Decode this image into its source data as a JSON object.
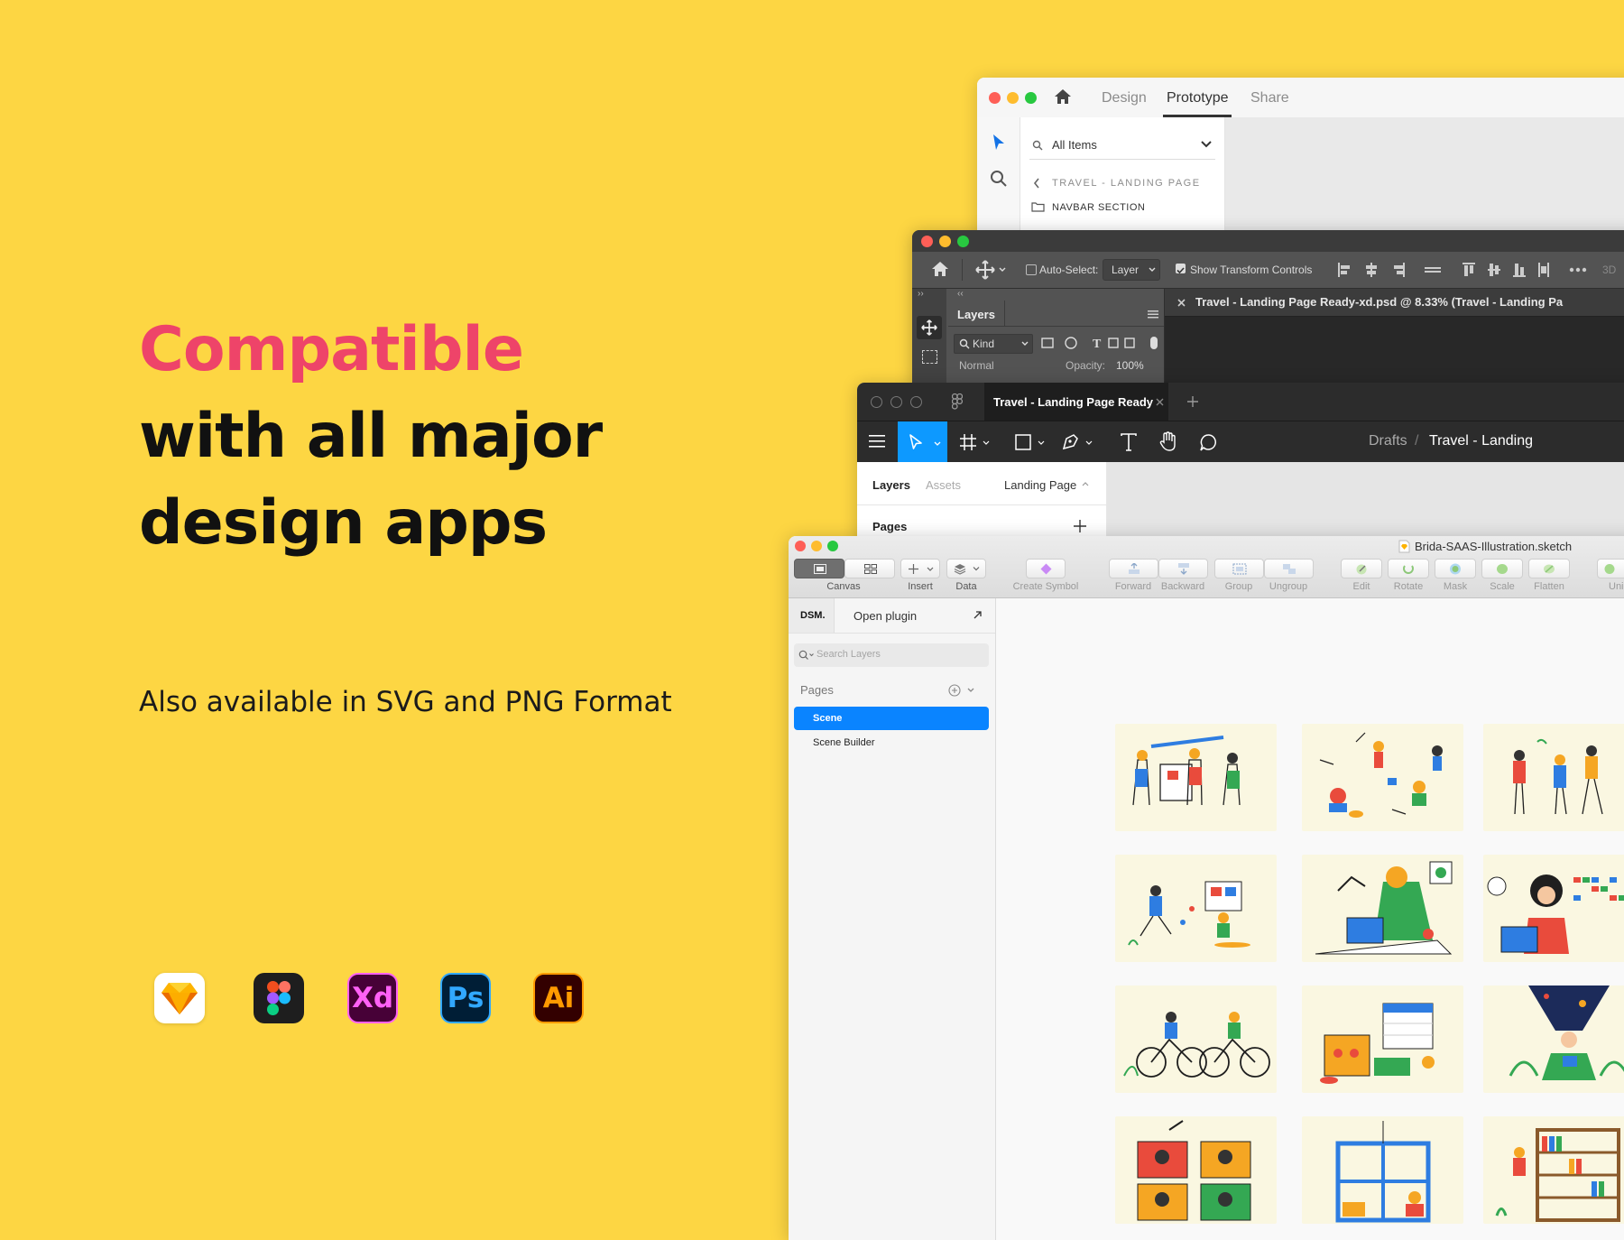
{
  "hero": {
    "line1": "Compatible",
    "line2": "with all major",
    "line3": "design apps",
    "subtitle": "Also available in SVG and PNG Format",
    "accent_color": "#EE4469",
    "background_color": "#FDD643"
  },
  "app_icons": [
    {
      "name": "sketch-icon",
      "label": ""
    },
    {
      "name": "figma-icon",
      "label": ""
    },
    {
      "name": "xd-icon",
      "label": "Xd"
    },
    {
      "name": "photoshop-icon",
      "label": "Ps"
    },
    {
      "name": "illustrator-icon",
      "label": "Ai"
    }
  ],
  "xd": {
    "tabs": [
      "Design",
      "Prototype",
      "Share"
    ],
    "active_tab": "Prototype",
    "filter_label": "All Items",
    "breadcrumb": "TRAVEL - LANDING PAGE",
    "folder": "NAVBAR SECTION"
  },
  "ps": {
    "auto_select_label": "Auto-Select:",
    "auto_select_value": "Layer",
    "transform_label": "Show Transform Controls",
    "panel_title": "Layers",
    "kind_label": "Kind",
    "blend_mode": "Normal",
    "opacity_label": "Opacity:",
    "opacity_value": "100%",
    "doc_tab": "Travel - Landing Page Ready-xd.psd @ 8.33% (Travel - Landing Pa",
    "more_label": "3D"
  },
  "figma": {
    "tab_title": "Travel - Landing Page Ready",
    "breadcrumb_root": "Drafts",
    "breadcrumb_sep": "/",
    "breadcrumb_file": "Travel - Landing",
    "panel_tabs": [
      "Layers",
      "Assets"
    ],
    "page_selector": "Landing Page",
    "pages_header": "Pages"
  },
  "sketch": {
    "file_name": "Brida-SAAS-Illustration.sketch",
    "toolbar": {
      "canvas": "Canvas",
      "insert": "Insert",
      "data": "Data",
      "create_symbol": "Create Symbol",
      "forward": "Forward",
      "backward": "Backward",
      "group": "Group",
      "ungroup": "Ungroup",
      "edit": "Edit",
      "rotate": "Rotate",
      "mask": "Mask",
      "scale": "Scale",
      "flatten": "Flatten",
      "union": "Unio"
    },
    "dsm_label": "DSM.",
    "open_plugin": "Open plugin",
    "search_placeholder": "Search Layers",
    "pages_header": "Pages",
    "pages": [
      "Scene",
      "Scene Builder"
    ],
    "selected_page": "Scene",
    "selection_color": "#0A84FF"
  }
}
